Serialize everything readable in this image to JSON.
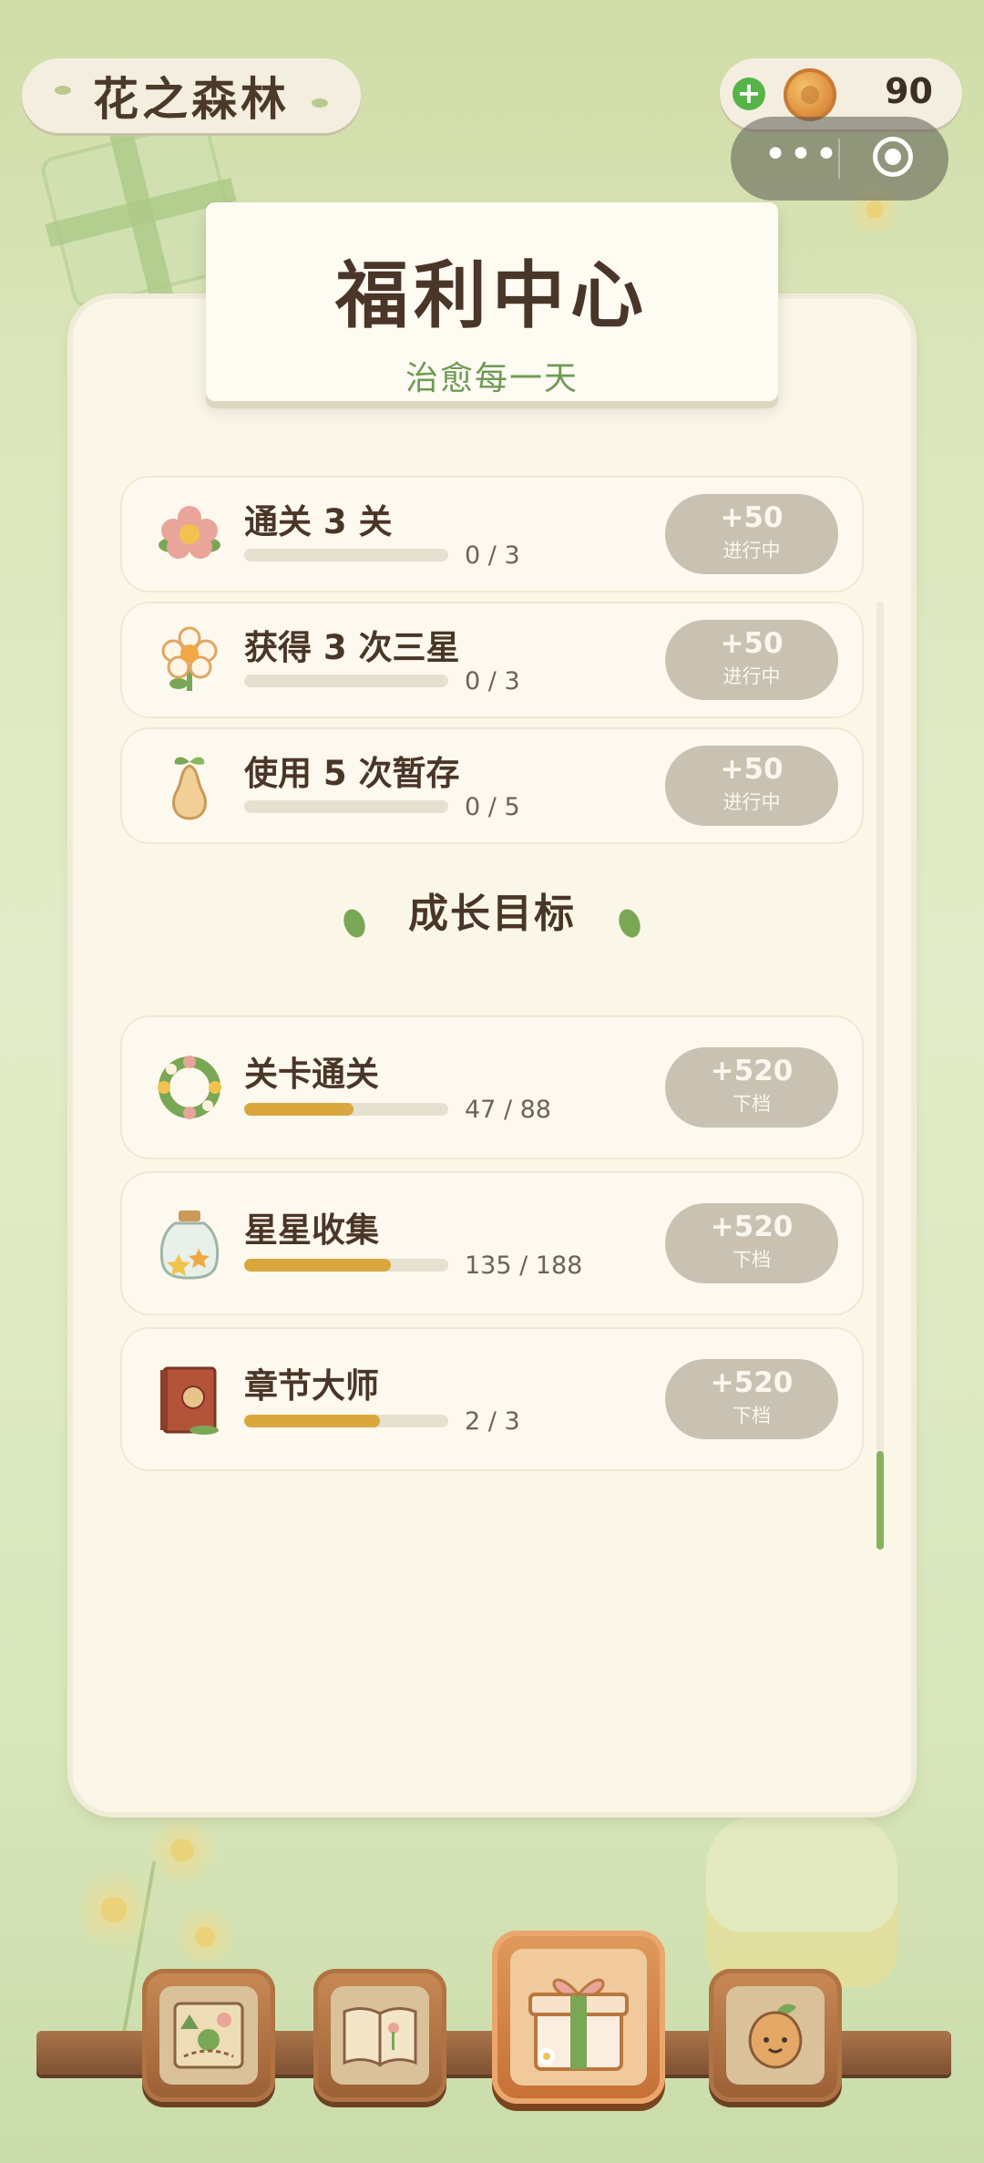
{
  "app": {
    "logo_text": "花之森林"
  },
  "currency": {
    "add_icon": "plus-icon",
    "coin_icon": "coin-icon",
    "amount": "90"
  },
  "capsule": {
    "more_label": "•••",
    "close_icon": "target-icon"
  },
  "header": {
    "title": "福利中心",
    "subtitle": "治愈每一天"
  },
  "daily_tasks": [
    {
      "icon": "flower-icon",
      "title": "通关 3 关",
      "count": "0 / 3",
      "progress": 0,
      "reward": "+50",
      "status": "进行中"
    },
    {
      "icon": "daisy-icon",
      "title": "获得 3 次三星",
      "count": "0 / 3",
      "progress": 0,
      "reward": "+50",
      "status": "进行中"
    },
    {
      "icon": "pear-icon",
      "title": "使用 5 次暂存",
      "count": "0 / 5",
      "progress": 0,
      "reward": "+50",
      "status": "进行中"
    }
  ],
  "growth_section": {
    "title": "成长目标"
  },
  "growth_tasks": [
    {
      "icon": "wreath-icon",
      "title": "关卡通关",
      "count": "47 / 88",
      "progress": 0.534,
      "reward": "+520",
      "status": "下档"
    },
    {
      "icon": "star-jar-icon",
      "title": "星星收集",
      "count": "135 / 188",
      "progress": 0.718,
      "reward": "+520",
      "status": "下档"
    },
    {
      "icon": "book-icon",
      "title": "章节大师",
      "count": "2 / 3",
      "progress": 0.667,
      "reward": "+520",
      "status": "下档"
    }
  ],
  "bottom_nav": [
    {
      "icon": "map-icon",
      "active": false
    },
    {
      "icon": "open-book-icon",
      "active": false
    },
    {
      "icon": "gift-box-icon",
      "active": true
    },
    {
      "icon": "seed-icon",
      "active": false
    }
  ],
  "colors": {
    "accent_green": "#6f9a55",
    "progress_gold": "#d9a73e",
    "reward_pill": "#c9c2b3",
    "coin_plus": "#55b347"
  }
}
